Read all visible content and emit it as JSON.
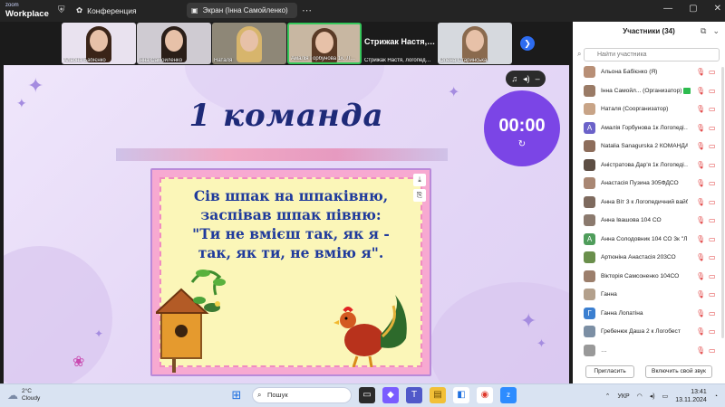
{
  "titlebar": {
    "brand_top": "zoom",
    "brand_bottom": "Workplace",
    "meeting_label": "Конференция",
    "screen_share_label": "Экран (Інна Самойленко)"
  },
  "thumbnails": [
    {
      "name": "Альона Бабієнко",
      "active": false
    },
    {
      "name": "Інна Самойленко",
      "active": false
    },
    {
      "name": "Наталя",
      "active": false
    },
    {
      "name": "Амалія Горбунова 1к. Логоп…",
      "active": true
    },
    {
      "name": "Стрижак Настя, логопед…",
      "big": "Стрижак Настя,…",
      "active": false
    },
    {
      "name": "Олена Старинська",
      "active": false
    }
  ],
  "slide": {
    "title": "1 команда",
    "poem": [
      "Сів шпак на шпаківню,",
      "заспівав шпак півню:",
      "\"Ти не вмієш так, як я -",
      "так, як ти, не вмію я\"."
    ]
  },
  "timer": {
    "value": "00:00",
    "reset_icon": "↻"
  },
  "panel": {
    "title": "Участники (34)",
    "search_placeholder": "Найти участника",
    "participants": [
      {
        "name": "Альона Бабієнко (Я)",
        "avatar": "",
        "color": "#b88f76"
      },
      {
        "name": "Інна Самойл... (Организатор)",
        "avatar": "",
        "color": "#9a7b66",
        "sharing": true
      },
      {
        "name": "Наталя (Соорганизатор)",
        "avatar": "",
        "color": "#c8a487"
      },
      {
        "name": "Амалія Горбунова 1к Логопеді…",
        "avatar": "А",
        "color": "#6b62c9"
      },
      {
        "name": "Natalia Sanagurska 2 КОМАНДА",
        "avatar": "",
        "color": "#8d6d5b"
      },
      {
        "name": "Аністратова Дар'я 1к Логопеді…",
        "avatar": "",
        "color": "#5d4e44"
      },
      {
        "name": "Анастасія Пузина 305ФДСО",
        "avatar": "",
        "color": "#a98773"
      },
      {
        "name": "Анна Віт 3 к Логопедичний вайб",
        "avatar": "",
        "color": "#7e6a5e"
      },
      {
        "name": "Анна Івашова 104 СО",
        "avatar": "",
        "color": "#8b7a6e"
      },
      {
        "name": "Анна Солодовник 104 СО 3к \"Л…",
        "avatar": "А",
        "color": "#4f9d5b"
      },
      {
        "name": "Артюніна Анастасія 203СО",
        "avatar": "",
        "color": "#6a8f4c"
      },
      {
        "name": "Вікторія Самсоненко 104СО",
        "avatar": "",
        "color": "#9c7f6c"
      },
      {
        "name": "Ганна",
        "avatar": "",
        "color": "#b3a08c"
      },
      {
        "name": "Ганна Лопатіна",
        "avatar": "Г",
        "color": "#3b7fd0"
      },
      {
        "name": "Гребенюк Даша 2 к Логобест",
        "avatar": "",
        "color": "#7c8fa4"
      },
      {
        "name": "…",
        "avatar": "",
        "color": "#999999"
      }
    ],
    "invite_label": "Пригласить",
    "unmute_label": "Включить свой звук"
  },
  "taskbar": {
    "temp": "2°C",
    "weather": "Cloudy",
    "search_label": "Пошук",
    "lang": "УКР",
    "time": "13:41",
    "date": "13.11.2024"
  }
}
